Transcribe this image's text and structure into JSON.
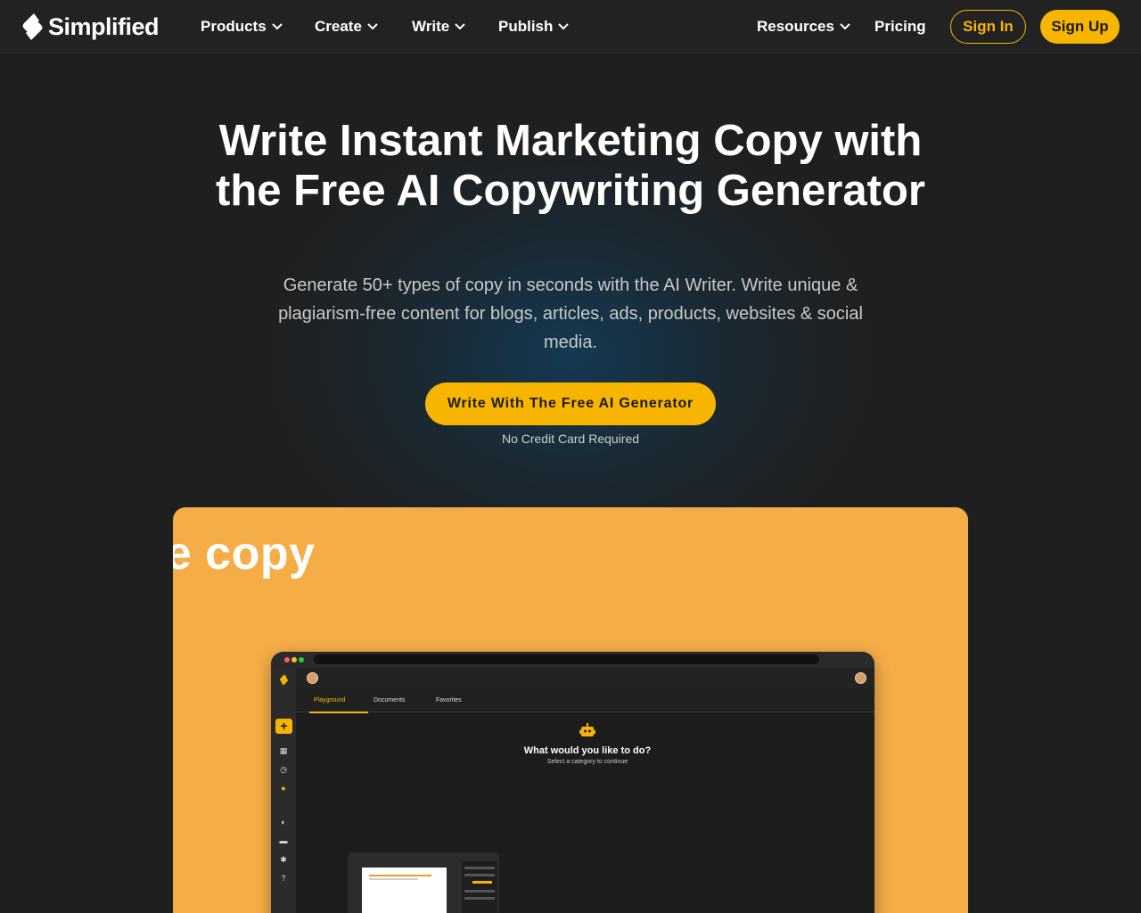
{
  "nav": {
    "brand": "Simplified",
    "items": [
      {
        "label": "Products"
      },
      {
        "label": "Create"
      },
      {
        "label": "Write"
      },
      {
        "label": "Publish"
      },
      {
        "label": "Resources"
      }
    ],
    "pricing": "Pricing",
    "sign_in": "Sign In",
    "sign_up": "Sign Up"
  },
  "hero": {
    "title": "Write Instant Marketing Copy with the Free AI Copywriting Generator",
    "subtitle": "Generate 50+ types of copy in seconds with the AI Writer. Write unique & plagiarism-free content for blogs, articles, ads, products, websites & social media.",
    "cta": "Write With The Free AI Generator",
    "note": "No Credit Card Required"
  },
  "showcase": {
    "headline": "te copy",
    "app": {
      "tabs": [
        "Playground",
        "Documents",
        "Favorites"
      ],
      "active_tab": "Playground",
      "prompt_title": "What would you like to do?",
      "prompt_subtitle": "Select a category to continue"
    }
  },
  "colors": {
    "accent": "#f7b500",
    "background": "#1f1f1f",
    "showcase_bg": "#f5ad47"
  }
}
